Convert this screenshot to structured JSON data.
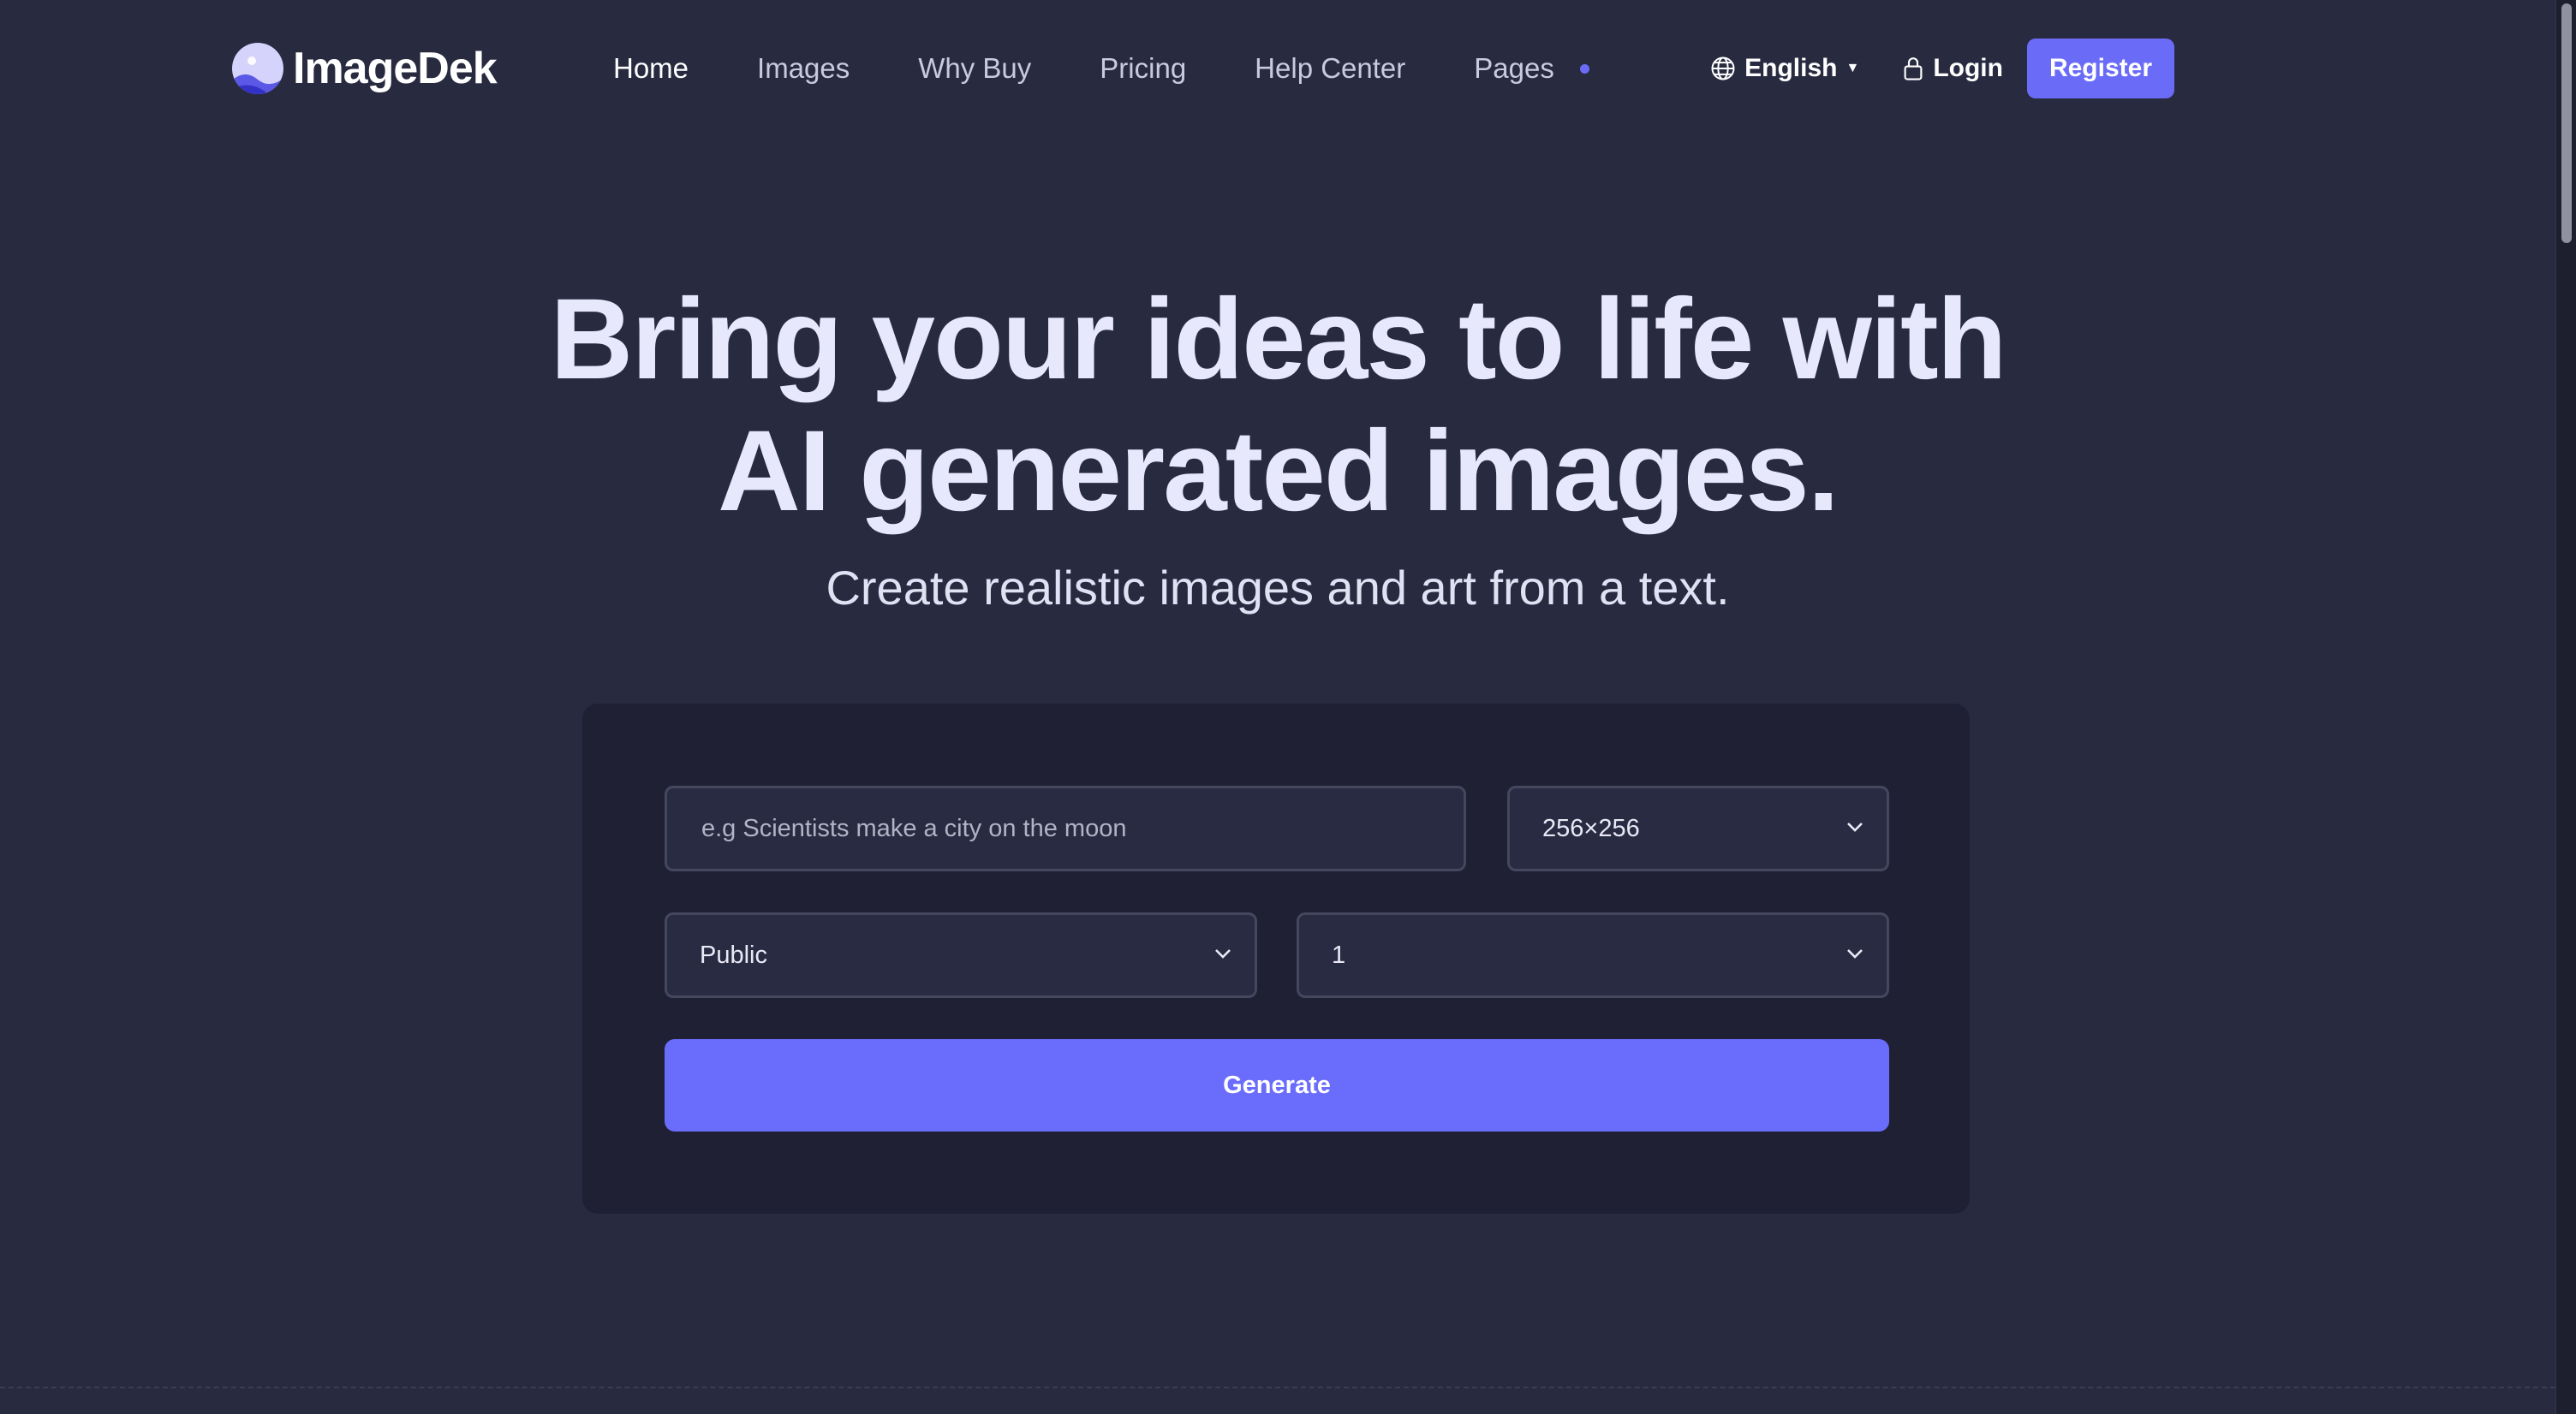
{
  "brand": {
    "name": "ImageDek"
  },
  "nav": {
    "items": [
      {
        "label": "Home",
        "active": true
      },
      {
        "label": "Images",
        "active": false
      },
      {
        "label": "Why Buy",
        "active": false
      },
      {
        "label": "Pricing",
        "active": false
      },
      {
        "label": "Help Center",
        "active": false
      },
      {
        "label": "Pages",
        "active": false
      }
    ]
  },
  "header": {
    "language": "English",
    "login_label": "Login",
    "register_label": "Register"
  },
  "hero": {
    "title_line1": "Bring your ideas to life with",
    "title_line2": "AI generated images.",
    "subtitle": "Create realistic images and art from a text."
  },
  "generator": {
    "prompt_placeholder": "e.g Scientists make a city on the moon",
    "prompt_value": "",
    "size_value": "256×256",
    "visibility_value": "Public",
    "count_value": "1",
    "generate_label": "Generate"
  },
  "colors": {
    "background": "#282a40",
    "card": "#1f2034",
    "accent": "#6a6cf8",
    "field_border": "#45475e"
  },
  "icons": {
    "logo": "moon-landscape-logo-icon",
    "language": "globe-icon",
    "login": "lock-icon",
    "dropdown": "chevron-down-icon",
    "pages_indicator": "dot-icon"
  }
}
